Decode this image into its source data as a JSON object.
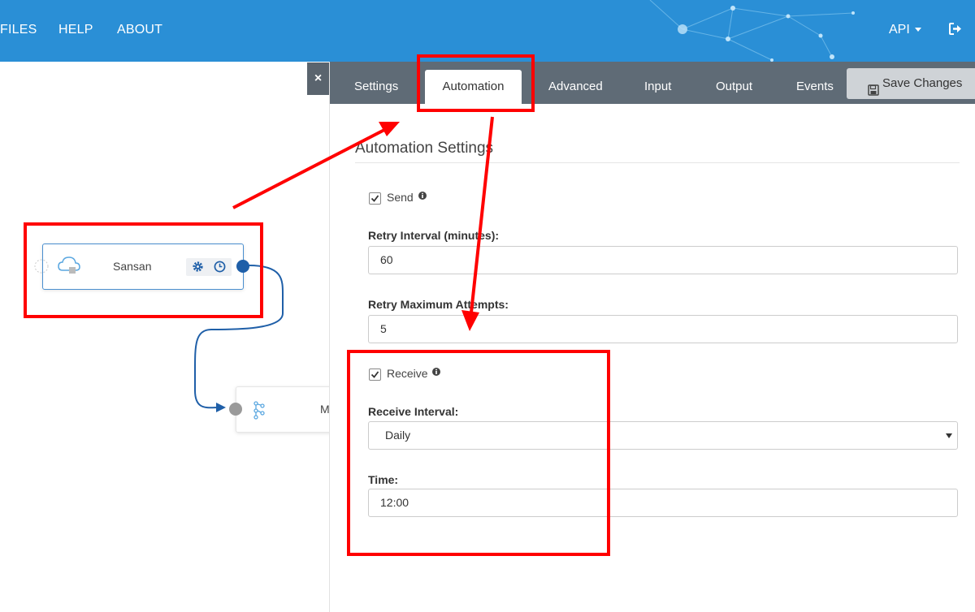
{
  "nav": {
    "items": [
      "FILES",
      "HELP",
      "ABOUT"
    ],
    "api_label": "API",
    "logout_icon": "sign-out-icon"
  },
  "canvas": {
    "close_label": "×",
    "node_sansan": {
      "label": "Sansan",
      "icons": [
        "cloud-icon",
        "gear-icon",
        "clock-icon"
      ]
    },
    "node_m": {
      "label": "M",
      "icon": "flow-icon"
    }
  },
  "panel": {
    "tabs": [
      "Settings",
      "Automation",
      "Advanced",
      "Input",
      "Output",
      "Events"
    ],
    "active_tab": "Automation",
    "save_label": "Save Changes",
    "section_title": "Automation Settings",
    "send": {
      "label": "Send",
      "checked": true
    },
    "retry_interval": {
      "label": "Retry Interval (minutes):",
      "value": "60"
    },
    "retry_max": {
      "label": "Retry Maximum Attempts:",
      "value": "5"
    },
    "receive": {
      "label": "Receive",
      "checked": true
    },
    "receive_interval": {
      "label": "Receive Interval:",
      "value": "Daily"
    },
    "time": {
      "label": "Time:",
      "value": "12:00"
    }
  },
  "colors": {
    "topbar": "#2a8fd6",
    "tabbar": "#5f6b76",
    "annotation": "#ff0000",
    "port_blue": "#1f5fa8",
    "port_gray": "#9a9a9a"
  }
}
